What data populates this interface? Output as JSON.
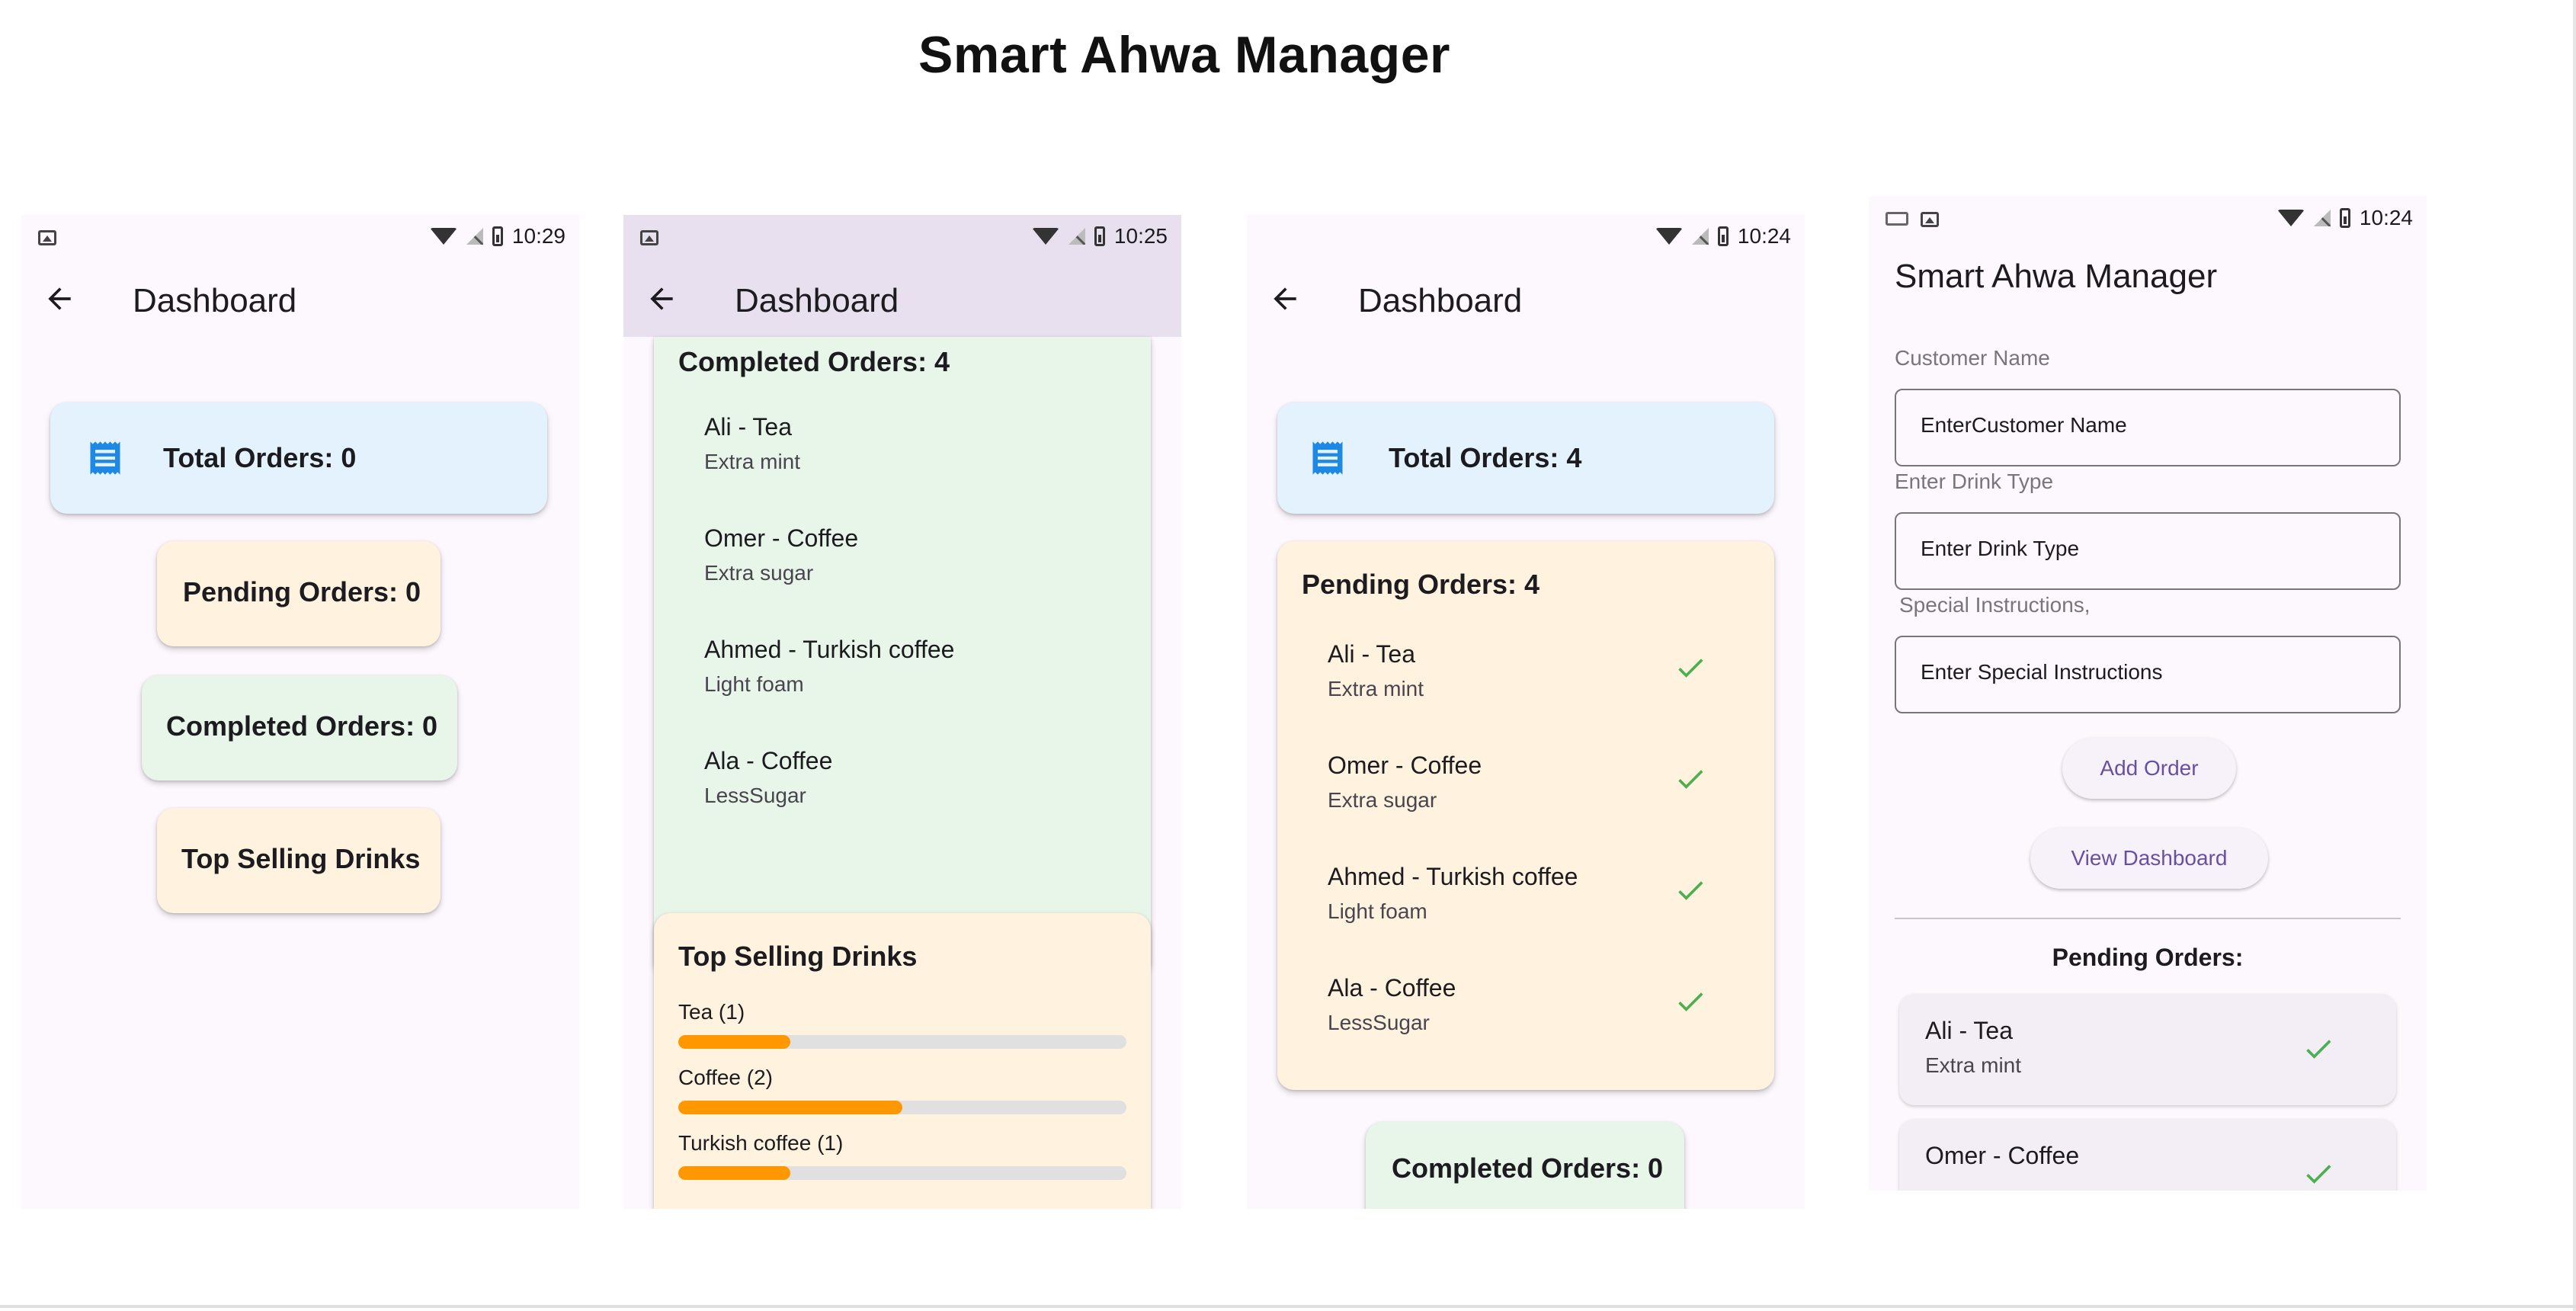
{
  "page_title": "Smart Ahwa Manager",
  "status_icons": [
    "image-icon",
    "wifi-icon",
    "no-signal-icon",
    "battery-icon",
    "keyboard-icon"
  ],
  "colors": {
    "blue_card": "#e3f2fd",
    "peach_card": "#fff3e0",
    "green_card": "#e8f5e9",
    "accent": "#6750a4",
    "check": "#4caf50",
    "bar": "#ff9800"
  },
  "screen1": {
    "time": "10:29",
    "appbar_title": "Dashboard",
    "total_orders": "Total Orders: 0",
    "pending_orders": "Pending Orders: 0",
    "completed_orders": "Completed Orders: 0",
    "top_selling": "Top Selling Drinks"
  },
  "screen2": {
    "time": "10:25",
    "appbar_title": "Dashboard",
    "completed_title": "Completed Orders: 4",
    "completed_items": [
      {
        "name": "Ali - Tea",
        "note": "Extra mint"
      },
      {
        "name": "Omer - Coffee",
        "note": "Extra sugar"
      },
      {
        "name": "Ahmed - Turkish coffee",
        "note": "Light foam"
      },
      {
        "name": "Ala - Coffee",
        "note": "LessSugar"
      }
    ],
    "top_selling_title": "Top Selling Drinks",
    "top_selling": [
      {
        "label": "Tea (1)",
        "fraction": 0.25
      },
      {
        "label": "Coffee (2)",
        "fraction": 0.5
      },
      {
        "label": "Turkish coffee (1)",
        "fraction": 0.25
      }
    ]
  },
  "screen3": {
    "time": "10:24",
    "appbar_title": "Dashboard",
    "total_orders": "Total Orders: 4",
    "pending_title": "Pending Orders: 4",
    "pending_items": [
      {
        "name": "Ali - Tea",
        "note": "Extra mint"
      },
      {
        "name": "Omer - Coffee",
        "note": "Extra sugar"
      },
      {
        "name": "Ahmed - Turkish coffee",
        "note": "Light foam"
      },
      {
        "name": "Ala - Coffee",
        "note": "LessSugar"
      }
    ],
    "completed_orders": "Completed Orders: 0"
  },
  "screen4": {
    "time": "10:24",
    "app_title": "Smart Ahwa Manager",
    "customer_label": "Customer Name",
    "customer_value": "EnterCustomer Name",
    "drink_label": "Enter Drink Type",
    "drink_value": "Enter Drink Type",
    "instructions_label": "Special Instructions,",
    "instructions_value": "Enter Special Instructions",
    "add_order": "Add Order",
    "view_dashboard": "View Dashboard",
    "pending_heading": "Pending Orders:",
    "pending_items": [
      {
        "name": "Ali - Tea",
        "note": "Extra mint"
      },
      {
        "name": "Omer - Coffee",
        "note": ""
      }
    ]
  }
}
